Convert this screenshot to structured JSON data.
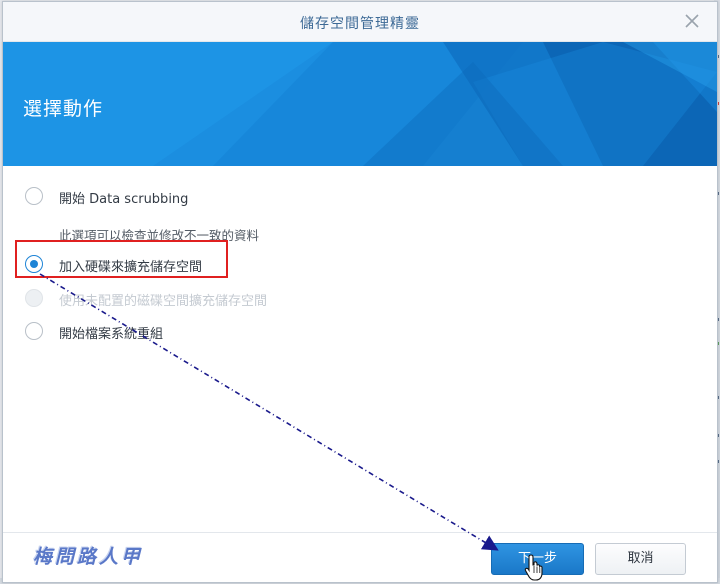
{
  "window": {
    "title": "儲存空間管理精靈",
    "close_icon": "close-icon"
  },
  "banner": {
    "heading": "選擇動作",
    "color": "#1b8ee0"
  },
  "options": [
    {
      "label": "開始 Data scrubbing",
      "checked": false,
      "disabled": false
    },
    {
      "label": "加入硬碟來擴充儲存空間",
      "checked": true,
      "disabled": false
    },
    {
      "label": "使用未配置的磁碟空間擴充儲存空間",
      "checked": false,
      "disabled": true
    },
    {
      "label": "開始檔案系統重組",
      "checked": false,
      "disabled": false
    }
  ],
  "option_description": "此選項可以檢查並修改不一致的資料",
  "watermark": "梅問路人甲",
  "buttons": {
    "next": "下一步",
    "cancel": "取消"
  },
  "colors": {
    "accent": "#1e84d6",
    "annotation_box": "#e02020",
    "annotation_arrow": "#1a1a8c"
  }
}
